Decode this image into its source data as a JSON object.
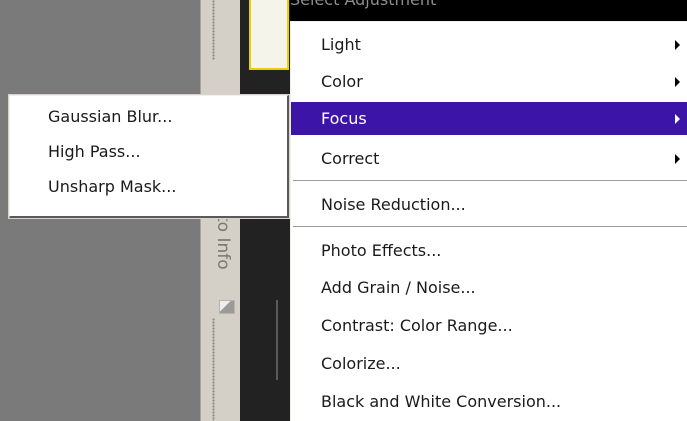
{
  "panel": {
    "title": "Select Adjustment",
    "vertical_label": "to Info"
  },
  "main_menu": {
    "items": [
      {
        "label": "Light",
        "has_submenu": true
      },
      {
        "label": "Color",
        "has_submenu": true
      },
      {
        "label": "Focus",
        "has_submenu": true,
        "highlighted": true
      },
      {
        "label": "Correct",
        "has_submenu": true
      },
      {
        "label": "Noise Reduction..."
      },
      {
        "label": "Photo Effects..."
      },
      {
        "label": "Add Grain / Noise..."
      },
      {
        "label": "Contrast: Color Range..."
      },
      {
        "label": "Colorize..."
      },
      {
        "label": "Black and White Conversion..."
      }
    ]
  },
  "focus_submenu": {
    "items": [
      {
        "label": "Gaussian Blur..."
      },
      {
        "label": "High Pass..."
      },
      {
        "label": "Unsharp Mask..."
      }
    ]
  },
  "colors": {
    "highlight": "#3c14a8",
    "preview_border": "#e8d000"
  }
}
